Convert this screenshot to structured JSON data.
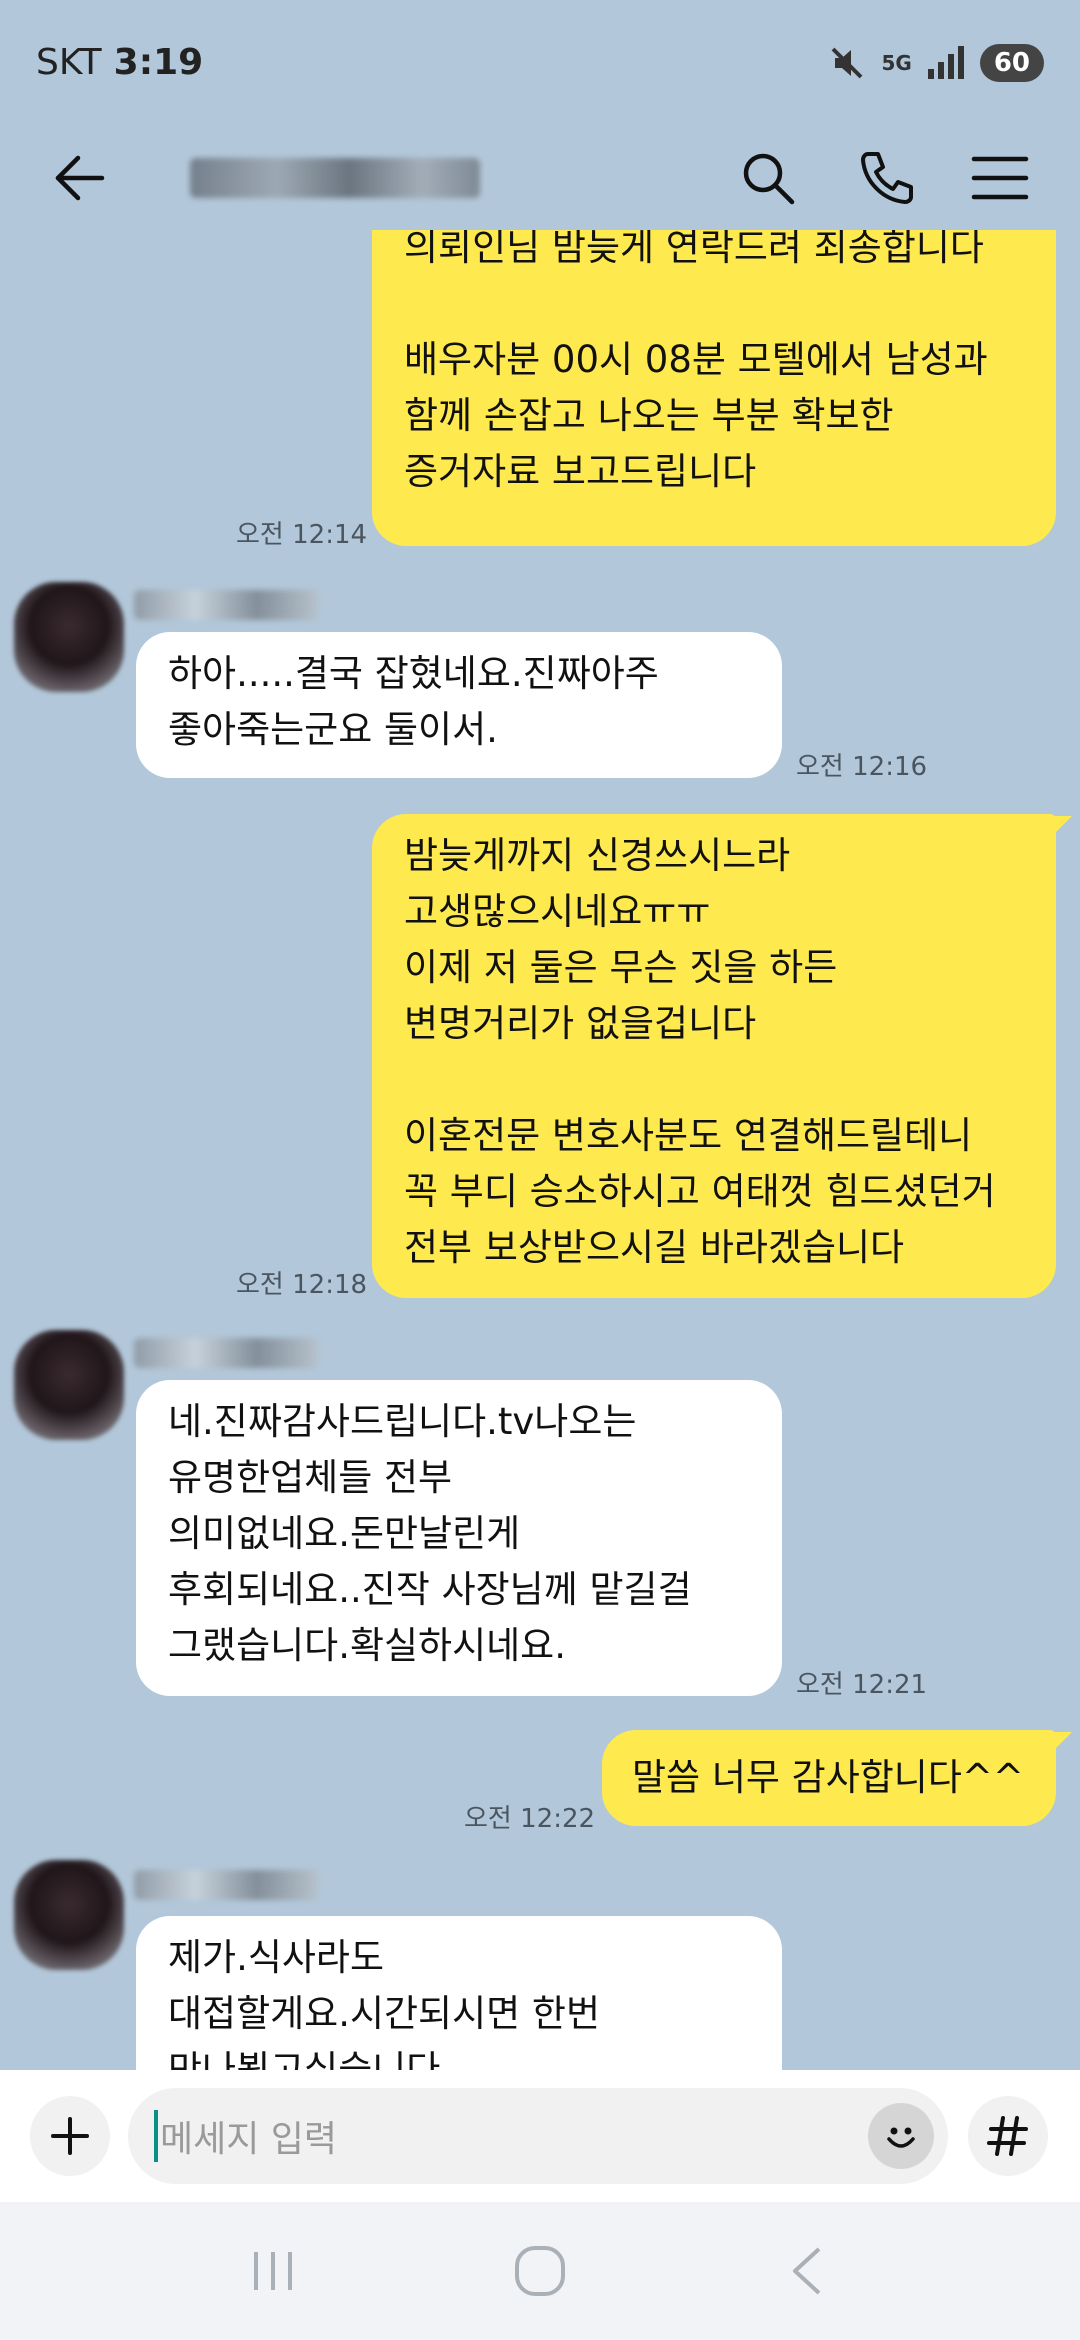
{
  "status_bar": {
    "carrier": "SKT",
    "time": "3:19",
    "network": "5G",
    "battery": "60"
  },
  "header": {
    "title": ""
  },
  "messages": [
    {
      "direction": "out",
      "text": "의뢰인님 밤늦게 연락드려 죄송합니다\n\n배우자분 00시 08분 모텔에서 남성과\n함께 손잡고 나오는 부분 확보한\n증거자료 보고드립니다",
      "time": "오전 12:14"
    },
    {
      "direction": "in",
      "text": "하아.....결국 잡혔네요.진짜아주\n좋아죽는군요 둘이서.",
      "time": "오전 12:16"
    },
    {
      "direction": "out",
      "text": "밤늦게까지 신경쓰시느라\n고생많으시네요ㅠㅠ\n이제 저 둘은 무슨 짓을 하든\n변명거리가 없을겁니다\n\n이혼전문 변호사분도 연결해드릴테니\n꼭 부디 승소하시고 여태껏 힘드셨던거\n전부 보상받으시길 바라겠습니다",
      "time": "오전 12:18"
    },
    {
      "direction": "in",
      "text": "네.진짜감사드립니다.tv나오는\n유명한업체들 전부\n의미없네요.돈만날린게\n후회되네요..진작 사장님께 맡길걸\n그랬습니다.확실하시네요.",
      "time": "오전 12:21"
    },
    {
      "direction": "out",
      "text": "말씀 너무 감사합니다^^",
      "time": "오전 12:22"
    },
    {
      "direction": "in",
      "text": "제가.식사라도\n대접할게요.시간되시면 한번\n만나뵙고싶습니다",
      "time": ""
    }
  ],
  "input": {
    "placeholder": "메세지 입력"
  },
  "colors": {
    "background": "#b2c7d9",
    "outgoing_bubble": "#fee94f",
    "incoming_bubble": "#ffffff"
  },
  "icons": [
    "back-arrow-icon",
    "search-icon",
    "phone-icon",
    "menu-icon",
    "plus-icon",
    "emoji-icon",
    "hash-icon",
    "recent-apps-icon",
    "home-icon",
    "nav-back-icon",
    "mute-icon",
    "signal-icon"
  ]
}
